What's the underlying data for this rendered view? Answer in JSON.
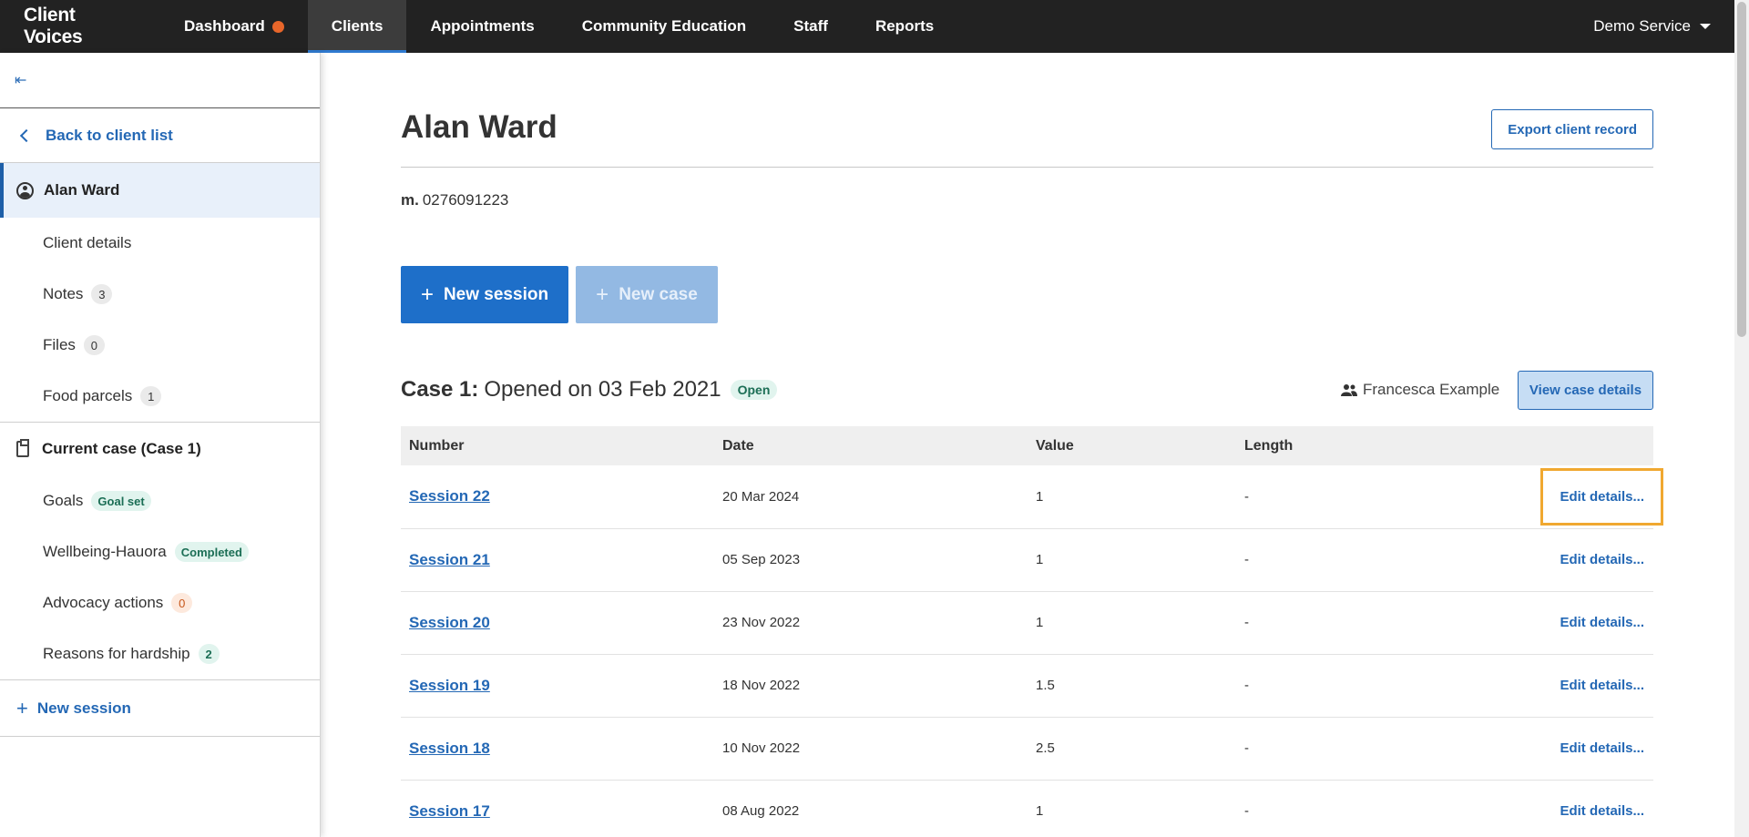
{
  "topbar": {
    "brand": "Client Voices",
    "nav": [
      {
        "label": "Dashboard"
      },
      {
        "label": "Clients"
      },
      {
        "label": "Appointments"
      },
      {
        "label": "Community Education"
      },
      {
        "label": "Staff"
      },
      {
        "label": "Reports"
      }
    ],
    "service": "Demo Service"
  },
  "sidebar": {
    "back_label": "Back to client list",
    "client_name": "Alan Ward",
    "client_items": [
      {
        "label": "Client details",
        "badge": ""
      },
      {
        "label": "Notes",
        "badge": "3"
      },
      {
        "label": "Files",
        "badge": "0"
      },
      {
        "label": "Food parcels",
        "badge": "1"
      }
    ],
    "case_label": "Current case (Case 1)",
    "case_items": [
      {
        "label": "Goals",
        "badge": "Goal set"
      },
      {
        "label": "Wellbeing-Hauora",
        "badge": "Completed"
      },
      {
        "label": "Advocacy actions",
        "badge": "0"
      },
      {
        "label": "Reasons for hardship",
        "badge": "2"
      }
    ],
    "new_session_label": "New session"
  },
  "main": {
    "title": "Alan Ward",
    "export_label": "Export client record",
    "phone_prefix": "m.",
    "phone": "0276091223",
    "new_session_label": "New session",
    "new_case_label": "New case",
    "case": {
      "label": "Case 1:",
      "opened": "Opened on 03 Feb 2021",
      "status": "Open",
      "assignee": "Francesca Example",
      "view_label": "View case details"
    },
    "table": {
      "headers": [
        "Number",
        "Date",
        "Value",
        "Length"
      ],
      "edit_label": "Edit details...",
      "rows": [
        {
          "number": "Session 22",
          "date": "20 Mar 2024",
          "value": "1",
          "length": "-"
        },
        {
          "number": "Session 21",
          "date": "05 Sep 2023",
          "value": "1",
          "length": "-"
        },
        {
          "number": "Session 20",
          "date": "23 Nov 2022",
          "value": "1",
          "length": "-"
        },
        {
          "number": "Session 19",
          "date": "18 Nov 2022",
          "value": "1.5",
          "length": "-"
        },
        {
          "number": "Session 18",
          "date": "10 Nov 2022",
          "value": "2.5",
          "length": "-"
        },
        {
          "number": "Session 17",
          "date": "08 Aug 2022",
          "value": "1",
          "length": "-"
        }
      ]
    }
  },
  "icons": {
    "collapse": "collapse-sidebar-icon",
    "back": "chevron-left-icon",
    "client": "person-circle-icon",
    "case": "clipboard-check-icon",
    "plus": "plus-icon",
    "people": "people-icon",
    "caret": "caret-down-icon"
  },
  "colors": {
    "accent": "#1e6fc9",
    "link": "#2468b5",
    "notification": "#e8662a",
    "focus": "#f0a830"
  }
}
